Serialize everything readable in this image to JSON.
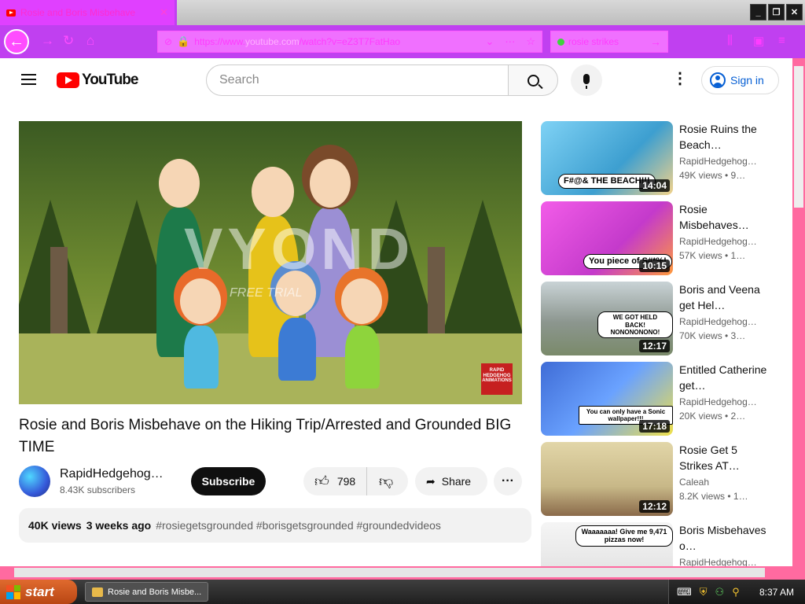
{
  "browser": {
    "tab_title": "Rosie and Boris Misbehave",
    "url_domain": "youtube.com",
    "url_prefix": "https://www.",
    "url_rest": "/watch?v=eZ3T7FatHao",
    "search_text": "rosie strikes"
  },
  "header": {
    "logo_text": "YouTube",
    "search_placeholder": "Search",
    "signin_label": "Sign in"
  },
  "video": {
    "watermark": "VYOND",
    "watermark_sub": "FREE TRIAL",
    "badge_text": "RAPID HEDGEHOG ANIMATIONS",
    "title": "Rosie and Boris Misbehave on the Hiking Trip/Arrested and Grounded BIG TIME",
    "channel_name": "RapidHedgehogAnimations",
    "subscribers": "8.43K subscribers",
    "subscribe_label": "Subscribe",
    "likes": "798",
    "share_label": "Share",
    "views": "40K views",
    "age": "3 weeks ago",
    "tags": "#rosiegetsgrounded #borisgetsgrounded #groundedvideos"
  },
  "related": [
    {
      "title": "Rosie Ruins the Beach…",
      "channel": "RapidHedgehog…",
      "meta": "49K views • 9…",
      "duration": "14:04",
      "caption": "F#@& THE BEACH!!!",
      "color": "#6ec6f0"
    },
    {
      "title": "Rosie Misbehaves…",
      "channel": "RapidHedgehog…",
      "meta": "57K views • 1…",
      "duration": "10:15",
      "caption": "You piece of S#*%!",
      "color": "#e64ddf"
    },
    {
      "title": "Boris and Veena get Hel…",
      "channel": "RapidHedgehog…",
      "meta": "70K views • 3…",
      "duration": "12:17",
      "caption": "WE GOT HELD BACK! NONONONONO!",
      "color": "#9aa6a0"
    },
    {
      "title": "Entitled Catherine get…",
      "channel": "RapidHedgehog…",
      "meta": "20K views • 2…",
      "duration": "17:18",
      "caption": "You can only have a Sonic wallpaper!!!",
      "color": "#3f6cd6"
    },
    {
      "title": "Rosie Get 5 Strikes AT…",
      "channel": "Caleah",
      "meta": "8.2K views • 1…",
      "duration": "12:12",
      "caption": "",
      "color": "#d8c89a"
    },
    {
      "title": "Boris Misbehaves o…",
      "channel": "RapidHedgehog…",
      "meta": "",
      "duration": "",
      "caption": "Waaaaaaa! Give me 9,471 pizzas now!",
      "color": "#f0f0f0"
    }
  ],
  "taskbar": {
    "start_label": "start",
    "task_label": "Rosie and Boris Misbe...",
    "clock": "8:37 AM"
  }
}
